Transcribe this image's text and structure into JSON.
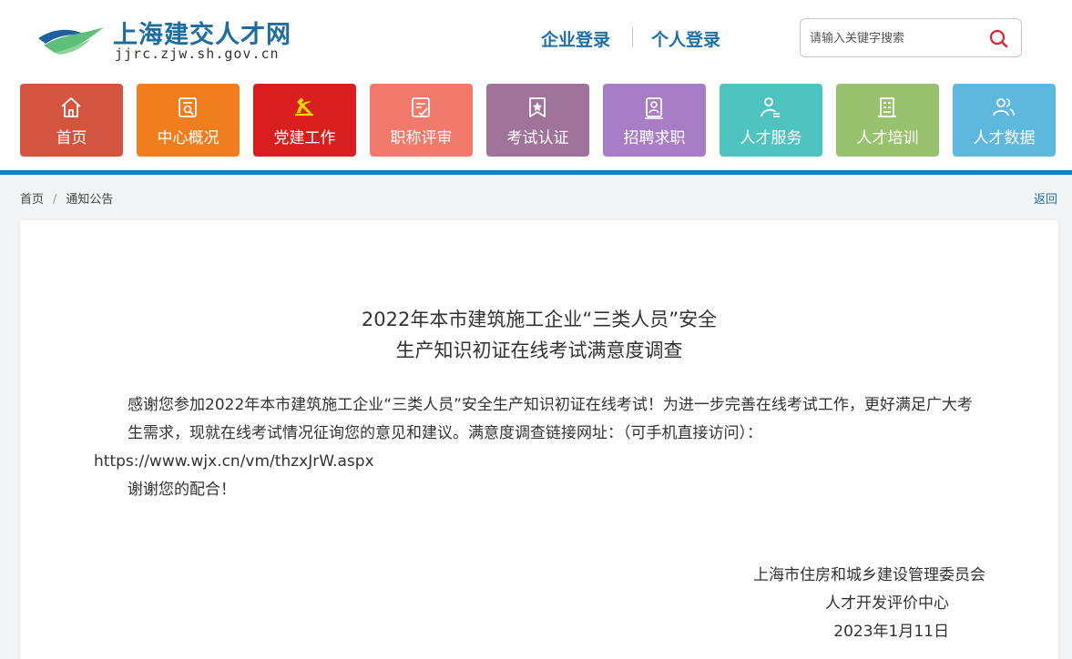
{
  "header": {
    "site_title": "上海建交人才网",
    "site_domain": "jjrc.zjw.sh.gov.cn",
    "enterprise_login": "企业登录",
    "personal_login": "个人登录",
    "search_placeholder": "请输入关键字搜索"
  },
  "nav": {
    "items": [
      {
        "label": "首页",
        "icon": "home-icon",
        "color": "#d4553f"
      },
      {
        "label": "中心概况",
        "icon": "search-document-icon",
        "color": "#f07d1e"
      },
      {
        "label": "党建工作",
        "icon": "party-emblem-icon",
        "color": "#d81e1e"
      },
      {
        "label": "职称评审",
        "icon": "checklist-icon",
        "color": "#f27a6c"
      },
      {
        "label": "考试认证",
        "icon": "certificate-star-icon",
        "color": "#a0739b"
      },
      {
        "label": "招聘求职",
        "icon": "badge-person-icon",
        "color": "#a77ec6"
      },
      {
        "label": "人才服务",
        "icon": "user-list-icon",
        "color": "#4fc3bf"
      },
      {
        "label": "人才培训",
        "icon": "building-icon",
        "color": "#99c26f"
      },
      {
        "label": "人才数据",
        "icon": "users-icon",
        "color": "#5eb7dc"
      }
    ]
  },
  "breadcrumb": {
    "home": "首页",
    "separator": "/",
    "current": "通知公告",
    "back": "返回"
  },
  "article": {
    "title_line1": "2022年本市建筑施工企业“三类人员”安全",
    "title_line2": "生产知识初证在线考试满意度调查",
    "para1": "感谢您参加2022年本市建筑施工企业“三类人员”安全生产知识初证在线考试！为进一步完善在线考试工作，更好满足广大考生需求，现就在线考试情况征询您的意见和建议。满意度调查链接网址：（可手机直接访问）：",
    "url": "https://www.wjx.cn/vm/thzxJrW.aspx",
    "thanks": "谢谢您的配合！",
    "org1": "上海市住房和城乡建设管理委员会",
    "org2": "人才开发评价中心",
    "date": "2023年1月11日"
  },
  "colors": {
    "brand_blue": "#1f6fa8",
    "rule_blue": "#1a7fb5",
    "search_red": "#d9232d"
  }
}
